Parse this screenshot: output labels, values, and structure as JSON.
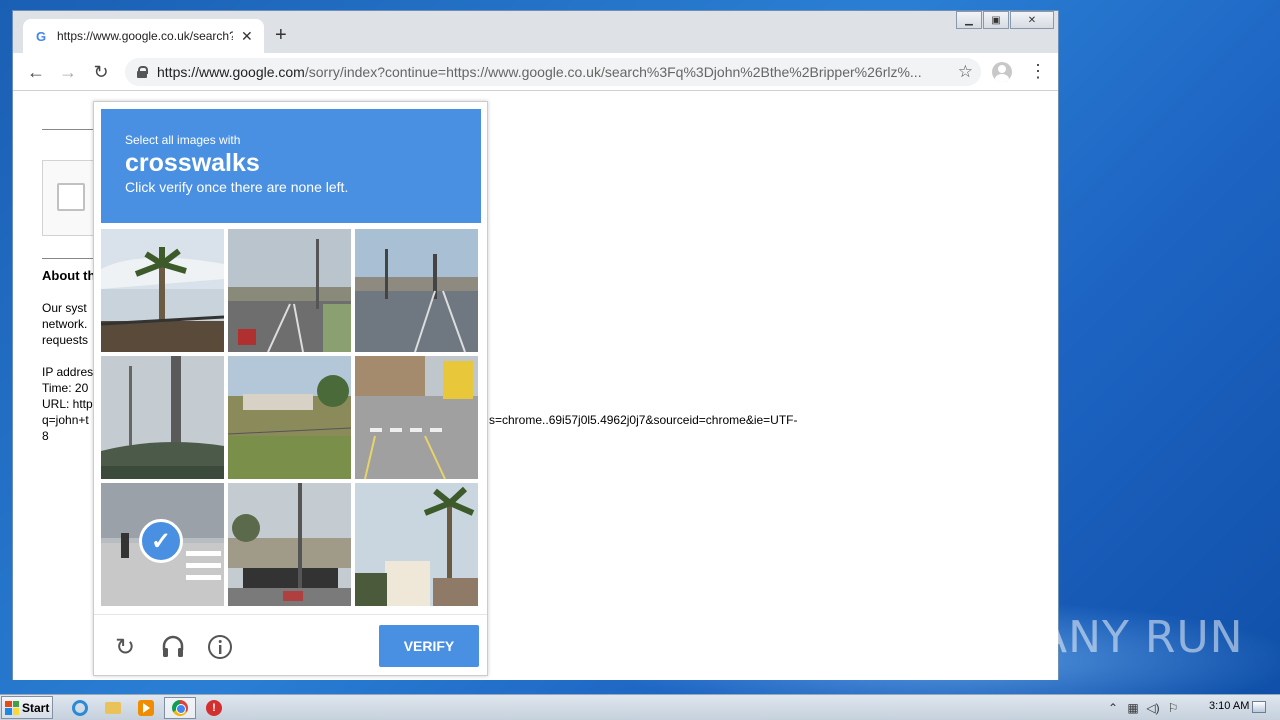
{
  "browser": {
    "tab_title": "https://www.google.co.uk/search?q=john+the+ripper",
    "tab_favicon": "G",
    "new_tab_glyph": "+",
    "url_host": "https://www.google.com",
    "url_path": "/sorry/index?continue=https://www.google.co.uk/search%3Fq%3Djohn%2Bthe%2Bripper%26rlz%...",
    "icons": [
      "back-icon",
      "forward-icon",
      "reload-icon",
      "lock-icon",
      "star-icon",
      "profile-icon",
      "menu-icon"
    ]
  },
  "page": {
    "about_title": "About th",
    "lines": [
      "Our syst",
      "network.",
      "requests",
      "",
      "IP addres",
      "Time: 20",
      "URL: http",
      "q=john+t",
      "8"
    ],
    "url_tail": "s=chrome..69i57j0l5.4962j0j7&sourceid=chrome&ie=UTF-"
  },
  "captcha": {
    "header_line1": "Select all images with",
    "keyword": "crosswalks",
    "header_line3": "Click verify once there are none left.",
    "tiles": [
      {
        "scene": "palm tree and sky",
        "selected": false
      },
      {
        "scene": "road under overpass",
        "selected": false
      },
      {
        "scene": "street with traffic lights",
        "selected": false
      },
      {
        "scene": "poles and overpass",
        "selected": false
      },
      {
        "scene": "field with buildings",
        "selected": false
      },
      {
        "scene": "street with crosswalk",
        "selected": false
      },
      {
        "scene": "intersection crosswalk",
        "selected": true
      },
      {
        "scene": "bridge over road",
        "selected": false
      },
      {
        "scene": "palm tree and houses",
        "selected": false
      }
    ],
    "verify_label": "VERIFY",
    "icons": [
      "reload-icon",
      "headphones-icon",
      "info-icon"
    ],
    "accent_color": "#4a90e2"
  },
  "watermark": "ANY RUN",
  "taskbar": {
    "start_label": "Start",
    "apps": [
      "ie-icon",
      "explorer-icon",
      "media-player-icon",
      "chrome-icon",
      "shield-icon"
    ],
    "clock": "3:10 AM"
  }
}
